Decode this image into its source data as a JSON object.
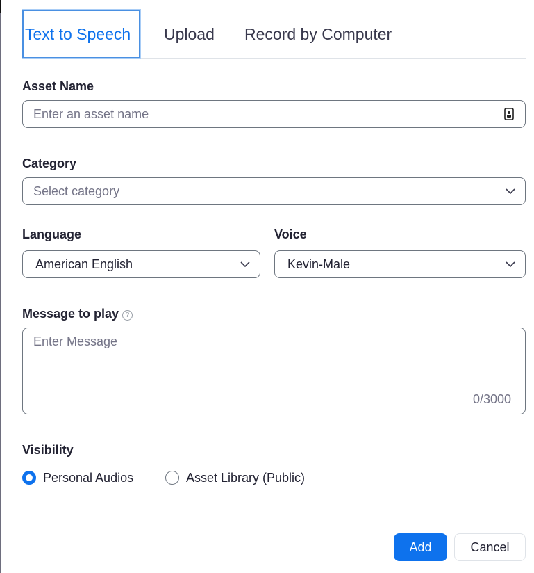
{
  "tabs": [
    {
      "label": "Text to Speech",
      "active": true
    },
    {
      "label": "Upload",
      "active": false
    },
    {
      "label": "Record by Computer",
      "active": false
    }
  ],
  "asset_name": {
    "label": "Asset Name",
    "placeholder": "Enter an asset name",
    "icon": "contact-card-icon"
  },
  "category": {
    "label": "Category",
    "placeholder": "Select category"
  },
  "language": {
    "label": "Language",
    "value": "American English"
  },
  "voice": {
    "label": "Voice",
    "value": "Kevin-Male"
  },
  "message": {
    "label": "Message to play",
    "help_icon": "?",
    "placeholder": "Enter Message",
    "counter": "0/3000"
  },
  "visibility": {
    "label": "Visibility",
    "options": [
      {
        "label": "Personal Audios",
        "checked": true
      },
      {
        "label": "Asset Library (Public)",
        "checked": false
      }
    ]
  },
  "buttons": {
    "add": "Add",
    "cancel": "Cancel"
  },
  "colors": {
    "accent": "#0e72ed",
    "text": "#232333",
    "placeholder": "#747487",
    "border": "#6e7680"
  }
}
